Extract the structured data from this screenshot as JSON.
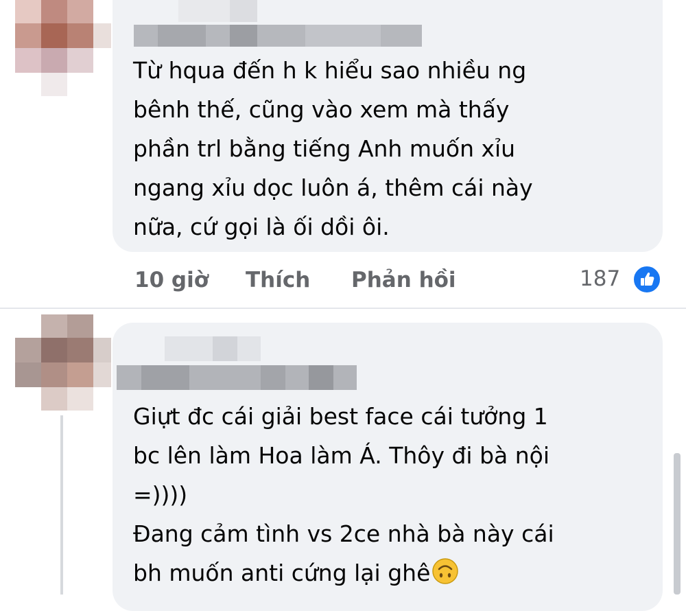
{
  "comments": [
    {
      "text_lines": [
        "Từ hqua đến h k hiểu sao nhiều ng",
        "bênh thế, cũng vào xem mà thấy",
        "phần trl bằng tiếng Anh muốn xỉu",
        "ngang xỉu dọc luôn á, thêm cái này",
        "nữa, cứ gọi là ối dồi ôi."
      ],
      "time": "10 giờ",
      "like_label": "Thích",
      "reply_label": "Phản hồi",
      "reaction_count": "187",
      "reaction_icon": "like-icon",
      "author_blurred": true
    },
    {
      "text_lines": [
        "Giựt đc cái giải best face cái tưởng 1",
        "bc lên làm Hoa làm Á. Thôy đi bà nội",
        "=))))",
        "Đang cảm tình vs 2ce nhà bà này cái",
        "bh muốn anti cứng lại ghê"
      ],
      "emoji": "upside-down-face",
      "author_blurred": true
    }
  ],
  "colors": {
    "bubble": "#f0f2f5",
    "text": "#050505",
    "meta": "#65676b",
    "like_blue": "#1877f2"
  }
}
